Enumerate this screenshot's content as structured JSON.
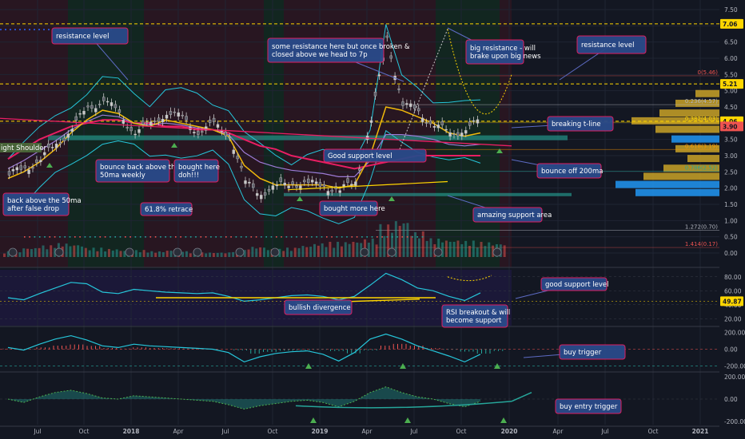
{
  "chart_data": {
    "type": "line",
    "title": "",
    "colors": {
      "background": "#131722",
      "price": "#c8c8c8",
      "ema_fast": "#f0b90b",
      "sma_slow": "#e91e63",
      "ma_mid": "#9c7bd6",
      "bollinger": "#26c6da",
      "resistance": "#ffd600",
      "support_zone": "#26a69a",
      "annotation_fill": "#2a4a8a",
      "annotation_border": "#e91e63",
      "volume_up": "#26a69a",
      "volume_down": "#ef5350",
      "oscillator": "#26c6da"
    },
    "price_axis": {
      "ticks": [
        "7.50",
        "7.00",
        "6.50",
        "6.00",
        "5.50",
        "5.00",
        "4.50",
        "4.00",
        "3.50",
        "3.00",
        "2.50",
        "2.00",
        "1.50",
        "1.00",
        "0.50",
        "0.00"
      ],
      "markers": [
        {
          "label": "7.06",
          "value": 7.06,
          "color": "#ffd600"
        },
        {
          "label": "5.21",
          "value": 5.21,
          "color": "#ffd600"
        },
        {
          "label": "4.06",
          "value": 4.06,
          "color": "#ffd600"
        },
        {
          "label": "3.90",
          "value": 3.9,
          "color": "#ef5350"
        }
      ]
    },
    "fib_labels": [
      {
        "label": "0(5.46)",
        "value": 5.46,
        "color": "#ef5350"
      },
      {
        "label": "0.236(4.57)",
        "value": 4.57,
        "color": "#b2b5be"
      },
      {
        "label": "0.382(4.03)",
        "value": 4.03,
        "color": "#ffd600"
      },
      {
        "label": "0.618(3.19)",
        "value": 3.19,
        "color": "#ff9800"
      },
      {
        "label": "0.786(2.52)",
        "value": 2.52,
        "color": "#26a69a"
      },
      {
        "label": "1.272(0.70)",
        "value": 0.7,
        "color": "#b2b5be"
      },
      {
        "label": "1.414(0.17)",
        "value": 0.17,
        "color": "#ef5350"
      }
    ],
    "x_ticks": [
      "Jul",
      "Oct",
      "2018",
      "Apr",
      "Jul",
      "Oct",
      "2019",
      "Apr",
      "Jul",
      "Oct",
      "2020",
      "Apr",
      "Jul",
      "Oct",
      "2021"
    ],
    "price_series": {
      "x_month_index": [
        0,
        1,
        2,
        3,
        4,
        5,
        6,
        7,
        8,
        9,
        10,
        11,
        12,
        13,
        14,
        15,
        16,
        17,
        18,
        19,
        20,
        21,
        22,
        23,
        24,
        25,
        26,
        27,
        28,
        29,
        30
      ],
      "values": [
        2.4,
        2.6,
        2.9,
        3.3,
        3.9,
        4.4,
        4.8,
        4.2,
        3.8,
        3.9,
        4.4,
        4.1,
        3.8,
        3.9,
        3.7,
        2.1,
        1.9,
        2.0,
        2.2,
        2.1,
        2.1,
        1.9,
        2.2,
        4.1,
        6.6,
        4.6,
        4.3,
        4.0,
        3.6,
        3.9,
        4.0
      ]
    },
    "ema_fast_values": [
      2.3,
      2.5,
      2.8,
      3.2,
      3.7,
      4.1,
      4.4,
      4.3,
      4.0,
      3.9,
      4.1,
      4.0,
      3.9,
      3.8,
      3.6,
      2.7,
      2.3,
      2.1,
      2.1,
      2.1,
      2.1,
      2.0,
      2.1,
      3.0,
      4.5,
      4.4,
      4.2,
      4.0,
      3.7,
      3.6,
      3.7
    ],
    "sma_slow_values": [
      2.9,
      3.2,
      3.5,
      3.7,
      3.9,
      4.0,
      4.1,
      4.1,
      4.0,
      4.0,
      3.9,
      3.9,
      3.8,
      3.8,
      3.7,
      3.5,
      3.3,
      3.2,
      3.0,
      2.9,
      2.8,
      2.7,
      2.6,
      2.7,
      2.8,
      2.9,
      3.0,
      3.0,
      3.0,
      3.0,
      3.0
    ],
    "volume": [
      0.5,
      0.8,
      1.0,
      1.2,
      1.1,
      0.8,
      0.7,
      0.6,
      0.6,
      0.5,
      0.6,
      0.5,
      0.4,
      0.4,
      0.6,
      0.9,
      0.7,
      0.8,
      1.0,
      1.2,
      1.3,
      1.4,
      1.6,
      2.8,
      3.2,
      2.2,
      1.6,
      1.5,
      1.4,
      1.3,
      1.2
    ],
    "rsi_values": [
      50,
      47,
      56,
      64,
      72,
      70,
      58,
      56,
      62,
      60,
      58,
      57,
      56,
      57,
      52,
      45,
      47,
      50,
      53,
      54,
      52,
      47,
      52,
      68,
      85,
      76,
      64,
      60,
      52,
      46,
      57
    ],
    "macd_values": [
      20,
      -10,
      60,
      120,
      160,
      110,
      40,
      20,
      60,
      40,
      30,
      20,
      10,
      0,
      -40,
      -150,
      -90,
      -50,
      -30,
      -20,
      -60,
      -140,
      -40,
      120,
      180,
      120,
      40,
      -20,
      -80,
      -150,
      -60
    ],
    "osc3_values": [
      0,
      -30,
      20,
      60,
      80,
      50,
      10,
      0,
      30,
      20,
      10,
      0,
      -10,
      -20,
      -50,
      -90,
      -60,
      -40,
      -20,
      -10,
      -30,
      -70,
      -20,
      60,
      110,
      60,
      20,
      0,
      -40,
      -70,
      -20
    ],
    "rsi_axis": [
      "80.00",
      "60.00",
      "40.00",
      "20.00"
    ],
    "rsi_marker": "49.87",
    "macd_axis": [
      "200.00",
      "0.00",
      "-200.00"
    ],
    "osc3_axis": [
      "200.00",
      "0.00",
      "-200.00"
    ],
    "resistance_levels": [
      7.06,
      5.21,
      4.06
    ],
    "annotations": [
      {
        "text": "resistance level"
      },
      {
        "text": "bounce back above the\n50ma weekly"
      },
      {
        "text": "bought here\ndoh!!!"
      },
      {
        "text": "61.8% retrace"
      },
      {
        "text": "back above the 50ma\nafter false drop"
      },
      {
        "text": "some resistance here but once broken &\nclosed above we head to 7p"
      },
      {
        "text": "Good support level"
      },
      {
        "text": "bought more here"
      },
      {
        "text": "big resistance - will\nbrake upon big news"
      },
      {
        "text": "resistance level"
      },
      {
        "text": "breaking t-line"
      },
      {
        "text": "bounce off 200ma"
      },
      {
        "text": "amazing support area"
      },
      {
        "text": "bullish divergence"
      },
      {
        "text": "RSI breakout & will\nbecome support"
      },
      {
        "text": "good support level"
      },
      {
        "text": "buy trigger"
      },
      {
        "text": "buy entry trigger"
      },
      {
        "text": "ight Shoulder"
      }
    ]
  }
}
